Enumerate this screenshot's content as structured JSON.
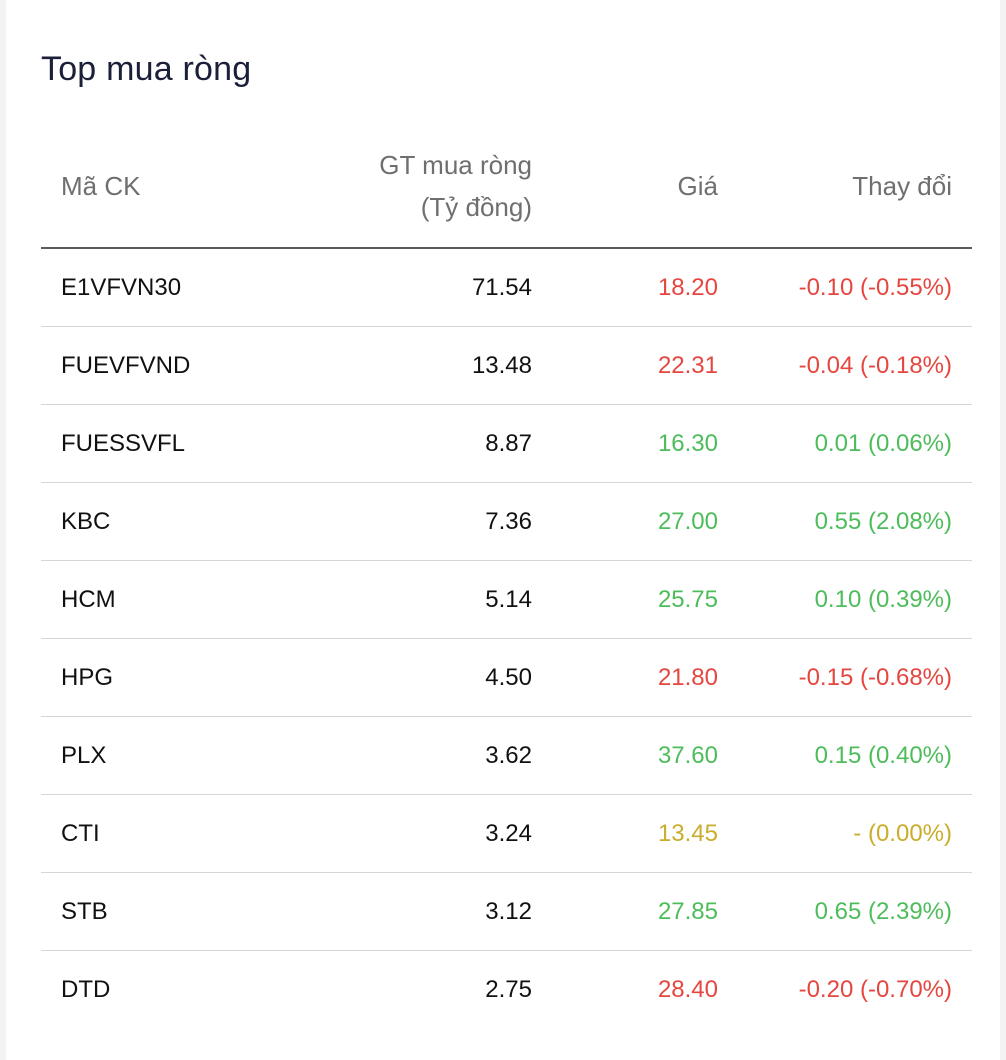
{
  "title": "Top mua ròng",
  "headers": {
    "code": "Mã CK",
    "value_line1": "GT mua ròng",
    "value_line2": "(Tỷ đồng)",
    "price": "Giá",
    "change": "Thay đổi"
  },
  "colors": {
    "down": "#e5463f",
    "up": "#4dbc5b",
    "unchanged": "#c9ad2c"
  },
  "rows": [
    {
      "code": "E1VFVN30",
      "value": "71.54",
      "price": "18.20",
      "change": "-0.10 (-0.55%)",
      "status": "down"
    },
    {
      "code": "FUEVFVND",
      "value": "13.48",
      "price": "22.31",
      "change": "-0.04 (-0.18%)",
      "status": "down"
    },
    {
      "code": "FUESSVFL",
      "value": "8.87",
      "price": "16.30",
      "change": "0.01 (0.06%)",
      "status": "up"
    },
    {
      "code": "KBC",
      "value": "7.36",
      "price": "27.00",
      "change": "0.55 (2.08%)",
      "status": "up"
    },
    {
      "code": "HCM",
      "value": "5.14",
      "price": "25.75",
      "change": "0.10 (0.39%)",
      "status": "up"
    },
    {
      "code": "HPG",
      "value": "4.50",
      "price": "21.80",
      "change": "-0.15 (-0.68%)",
      "status": "down"
    },
    {
      "code": "PLX",
      "value": "3.62",
      "price": "37.60",
      "change": "0.15 (0.40%)",
      "status": "up"
    },
    {
      "code": "CTI",
      "value": "3.24",
      "price": "13.45",
      "change": "- (0.00%)",
      "status": "unchanged"
    },
    {
      "code": "STB",
      "value": "3.12",
      "price": "27.85",
      "change": "0.65 (2.39%)",
      "status": "up"
    },
    {
      "code": "DTD",
      "value": "2.75",
      "price": "28.40",
      "change": "-0.20 (-0.70%)",
      "status": "down"
    }
  ]
}
